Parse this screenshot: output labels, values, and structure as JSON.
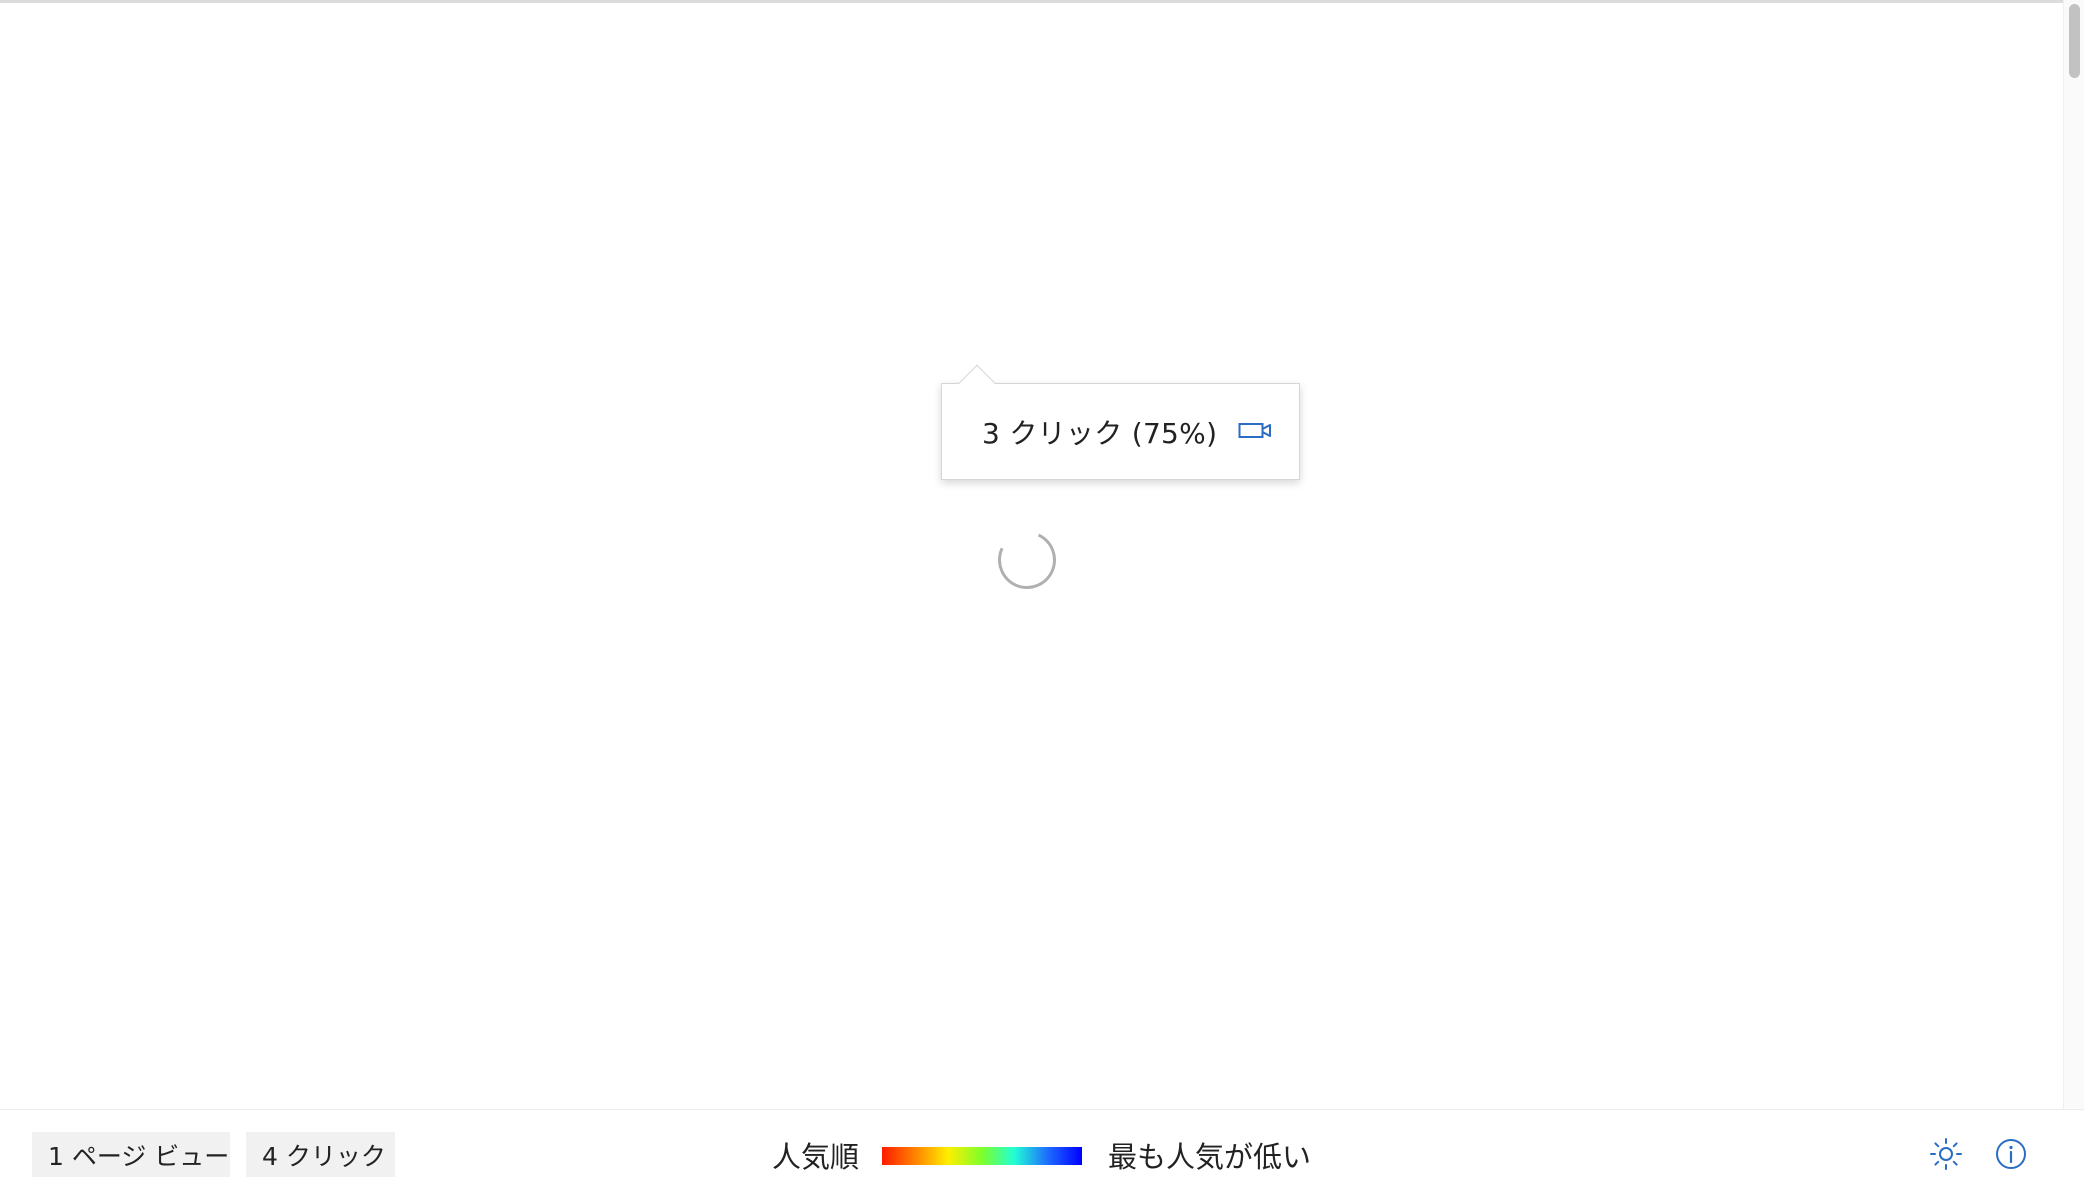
{
  "callout": {
    "text": "3 クリック (75%)",
    "action_icon": "video-camera-icon"
  },
  "loading": {
    "icon": "spinner-icon"
  },
  "bottom_bar": {
    "page_views_label": "1 ページ ビュー",
    "clicks_label": "4 クリック",
    "legend": {
      "most_popular": "人気順",
      "least_popular": "最も人気が低い",
      "gradient_colors": [
        "#ff1a00",
        "#ff8c00",
        "#ffee00",
        "#7dff2a",
        "#22ffd4",
        "#1e6bff",
        "#0000ff"
      ]
    },
    "theme_icon": "sun-icon",
    "info_icon": "info-icon"
  },
  "colors": {
    "accent": "#2b6cc4",
    "chip_background": "#f1f1f1",
    "spinner": "#b0b0b0"
  }
}
